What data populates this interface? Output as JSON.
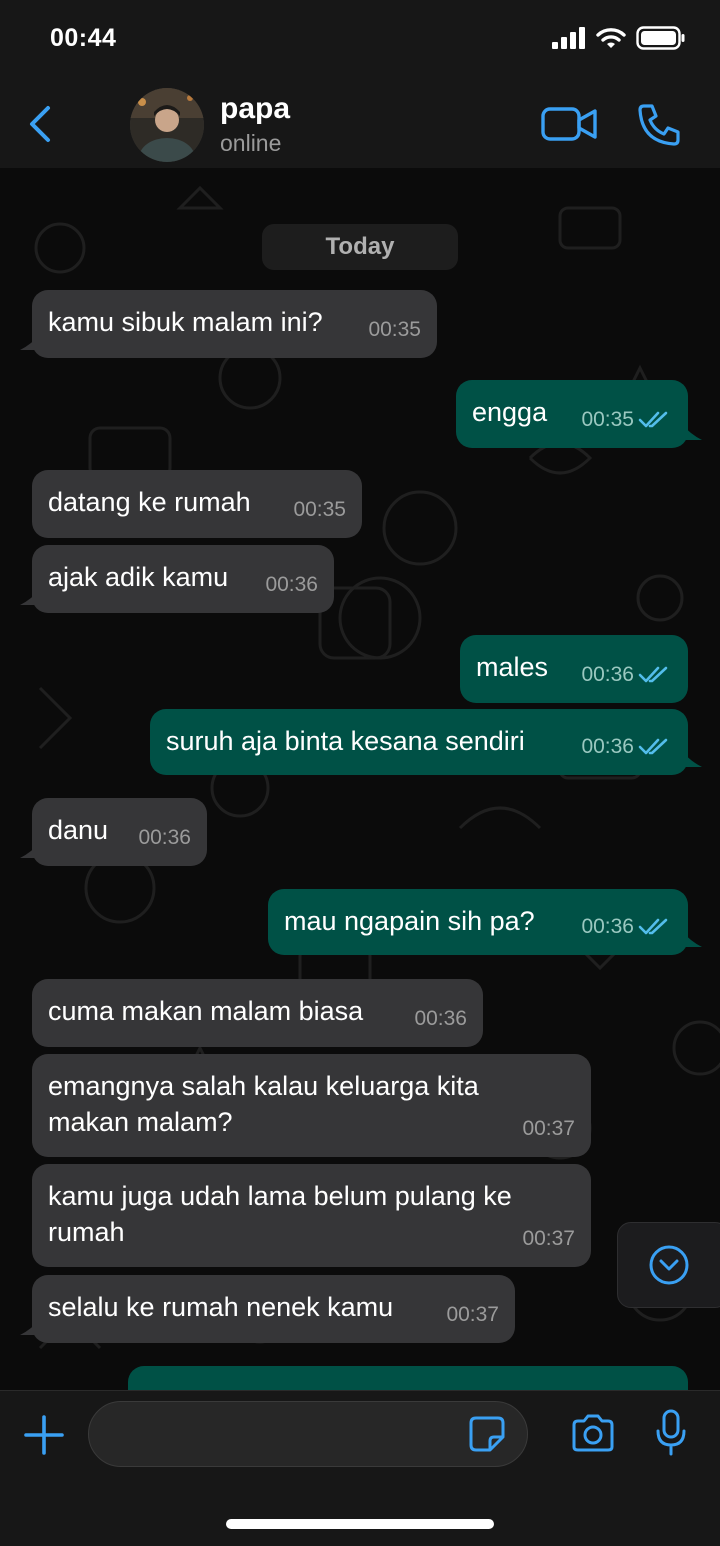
{
  "status_bar": {
    "time": "00:44"
  },
  "header": {
    "contact_name": "papa",
    "contact_status": "online"
  },
  "chat": {
    "date_label": "Today",
    "messages": [
      {
        "dir": "in",
        "text": "kamu sibuk malam ini?",
        "time": "00:35"
      },
      {
        "dir": "out",
        "text": "engga",
        "time": "00:35",
        "read": true
      },
      {
        "dir": "in",
        "text": "datang ke rumah",
        "time": "00:35"
      },
      {
        "dir": "in",
        "text": "ajak adik kamu",
        "time": "00:36"
      },
      {
        "dir": "out",
        "text": "males",
        "time": "00:36",
        "read": true
      },
      {
        "dir": "out",
        "text": "suruh aja binta kesana sendiri",
        "time": "00:36",
        "read": true
      },
      {
        "dir": "in",
        "text": "danu",
        "time": "00:36"
      },
      {
        "dir": "out",
        "text": "mau ngapain sih pa?",
        "time": "00:36",
        "read": true
      },
      {
        "dir": "in",
        "text": "cuma makan malam biasa",
        "time": "00:36"
      },
      {
        "dir": "in",
        "text": "emangnya salah kalau keluarga kita\nmakan malam?",
        "time": "00:37"
      },
      {
        "dir": "in",
        "text": "kamu juga udah lama belum pulang ke\nrumah",
        "time": "00:37"
      },
      {
        "dir": "in",
        "text": "selalu ke rumah nenek kamu",
        "time": "00:37"
      }
    ]
  },
  "composer": {
    "input_value": ""
  },
  "colors": {
    "accent": "#3aa0f3",
    "bubble_in": "#363638",
    "bubble_out": "#005146",
    "read_ticks": "#53bdeb"
  },
  "icons": [
    "back-chevron-icon",
    "video-call-icon",
    "phone-call-icon",
    "scroll-down-icon",
    "plus-icon",
    "sticker-icon",
    "camera-icon",
    "microphone-icon"
  ]
}
